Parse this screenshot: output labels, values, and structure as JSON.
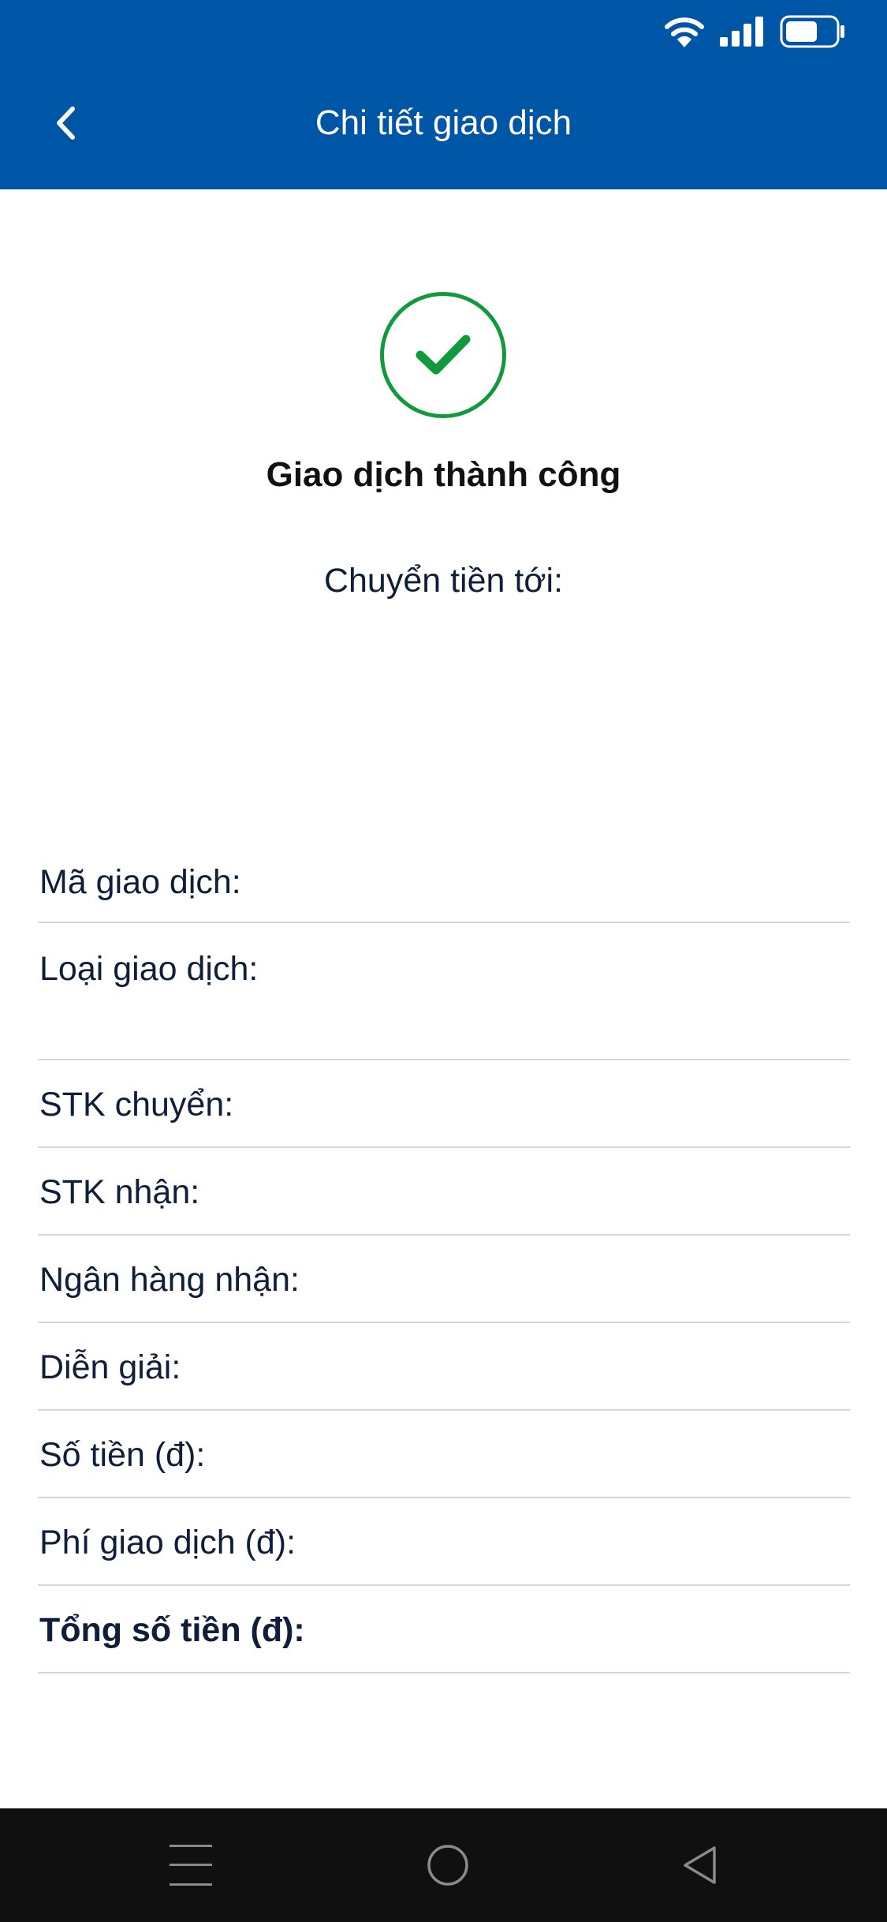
{
  "status_bar": {
    "icons": [
      "wifi-icon",
      "signal-icon",
      "battery-icon"
    ],
    "battery_level": 0.65
  },
  "header": {
    "title": "Chi tiết giao dịch",
    "back_icon": "chevron-left-icon",
    "background_color": "#0056a6"
  },
  "result": {
    "icon": "check-circle-icon",
    "title": "Giao dịch thành công",
    "transfer_to_label": "Chuyển tiền tới:",
    "accent_color": "#119a3c"
  },
  "details": [
    {
      "label": "Mã giao dịch:",
      "bold": false
    },
    {
      "label": "Loại giao dịch:",
      "bold": false
    },
    {
      "label": "STK chuyển:",
      "bold": false
    },
    {
      "label": "STK nhận:",
      "bold": false
    },
    {
      "label": "Ngân hàng nhận:",
      "bold": false
    },
    {
      "label": "Diễn giải:",
      "bold": false
    },
    {
      "label": "Số tiền (đ):",
      "bold": false
    },
    {
      "label": "Phí giao dịch (đ):",
      "bold": false
    },
    {
      "label": "Tổng số tiền (đ):",
      "bold": true
    }
  ],
  "nav_bar": {
    "buttons": [
      "menu-icon",
      "home-icon",
      "back-triangle-icon"
    ]
  }
}
